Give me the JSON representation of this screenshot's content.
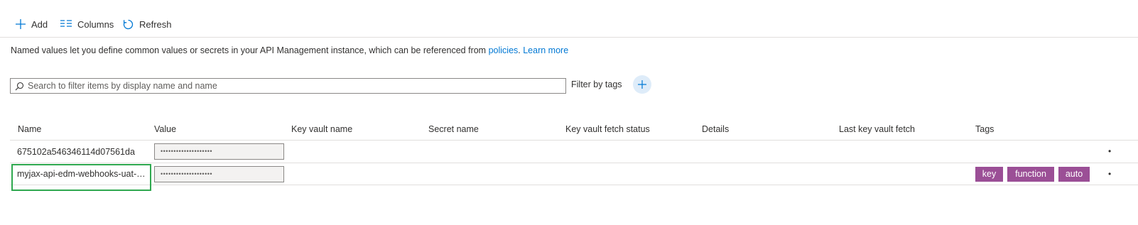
{
  "toolbar": {
    "add_label": "Add",
    "columns_label": "Columns",
    "refresh_label": "Refresh"
  },
  "description": {
    "text": "Named values let you define common values or secrets in your API Management instance, which can be referenced from ",
    "policies_link": "policies",
    "separator": ".",
    "learn_more_link": "Learn more"
  },
  "search": {
    "placeholder": "Search to filter items by display name and name",
    "value": ""
  },
  "filter": {
    "label": "Filter by tags"
  },
  "table": {
    "columns": [
      "Name",
      "Value",
      "Key vault name",
      "Secret name",
      "Key vault fetch status",
      "Details",
      "Last key vault fetch",
      "Tags"
    ],
    "rows": [
      {
        "name": "675102a546346114d07561da",
        "value": "••••••••••••••••••••",
        "tags": []
      },
      {
        "name": "myjax-api-edm-webhooks-uat-key",
        "value": "••••••••••••••••••••",
        "tags": [
          "key",
          "function",
          "auto"
        ]
      }
    ],
    "row_more": "•"
  },
  "colors": {
    "accent": "#0078d4",
    "tag_bg": "#9b4f96",
    "highlight": "#2fa84f"
  }
}
